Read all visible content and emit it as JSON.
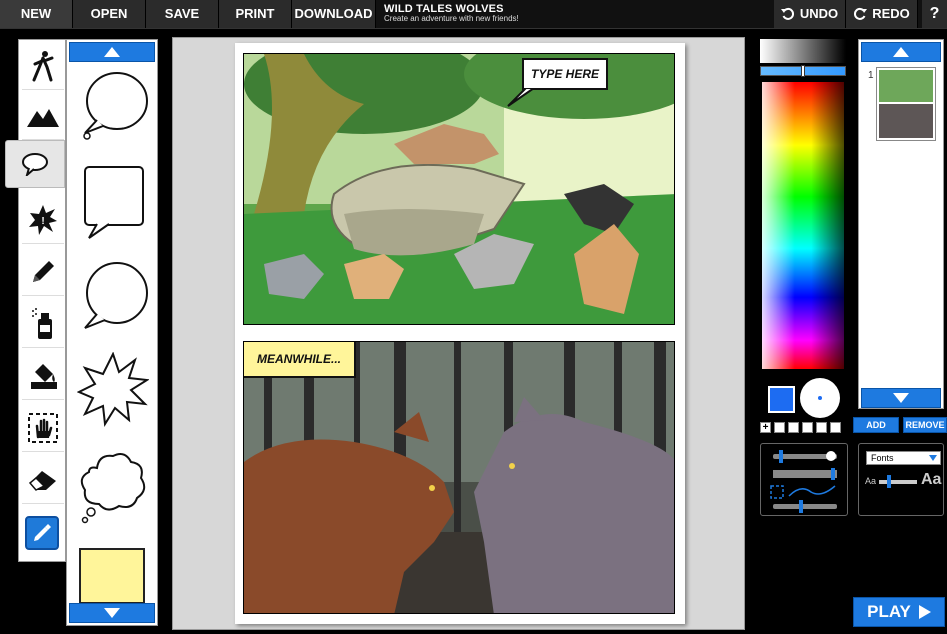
{
  "toolbar": {
    "new": "NEW",
    "open": "OPEN",
    "save": "SAVE",
    "print": "PRINT",
    "download": "DOWNLOAD",
    "undo": "UNDO",
    "redo": "REDO",
    "help": "?"
  },
  "app": {
    "title": "WILD TALES WOLVES",
    "subtitle": "Create an adventure with new friends!"
  },
  "tools": [
    "character-icon",
    "scenery-icon",
    "speech-bubble-icon",
    "burst-icon",
    "pencil-icon",
    "spray-can-icon",
    "paint-bucket-icon",
    "hand-select-icon",
    "eraser-icon",
    "eyedropper-icon"
  ],
  "active_tool": "speech-bubble-icon",
  "comic": {
    "panel1_caption": "TYPE HERE",
    "panel2_caption": "MEANWHILE..."
  },
  "pages": {
    "page_number": "1",
    "add": "ADD",
    "remove": "REMOVE"
  },
  "font": {
    "select_value": "Fonts",
    "small_label": "Aa",
    "large_label": "Aa"
  },
  "colors": {
    "accent": "#1e7ae0",
    "selected_color": "#1d6cf2",
    "caption_yellow": "#fff59a"
  },
  "play": "PLAY"
}
